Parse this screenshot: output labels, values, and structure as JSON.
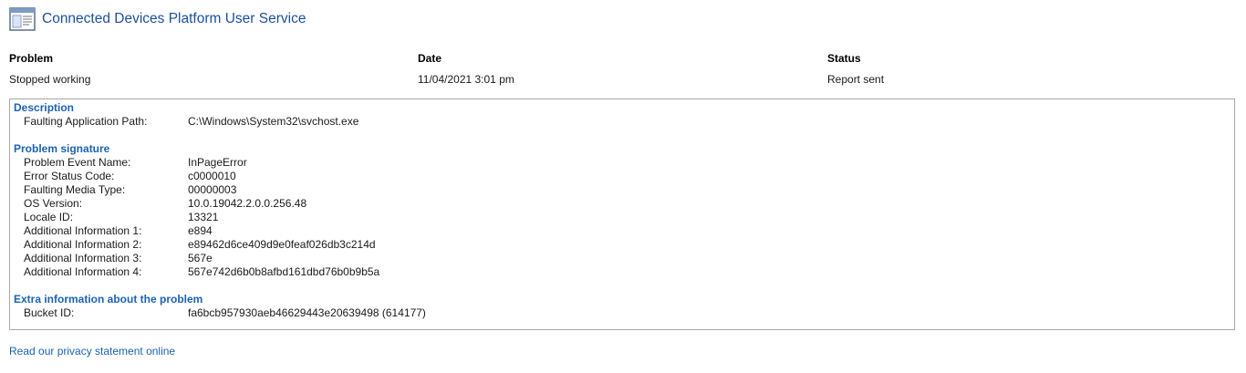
{
  "window": {
    "title": "Connected Devices Platform User Service",
    "icon": "report-document-icon"
  },
  "summary": {
    "headers": {
      "problem": "Problem",
      "date": "Date",
      "status": "Status"
    },
    "values": {
      "problem": "Stopped working",
      "date": "11/04/2021 3:01 pm",
      "status": "Report sent"
    }
  },
  "details": {
    "description": {
      "title": "Description",
      "rows": [
        {
          "key": "Faulting Application Path:",
          "value": "C:\\Windows\\System32\\svchost.exe"
        }
      ]
    },
    "signature": {
      "title": "Problem signature",
      "rows": [
        {
          "key": "Problem Event Name:",
          "value": "InPageError"
        },
        {
          "key": "Error Status Code:",
          "value": "c0000010"
        },
        {
          "key": "Faulting Media Type:",
          "value": "00000003"
        },
        {
          "key": "OS Version:",
          "value": "10.0.19042.2.0.0.256.48"
        },
        {
          "key": "Locale ID:",
          "value": "13321"
        },
        {
          "key": "Additional Information 1:",
          "value": "e894"
        },
        {
          "key": "Additional Information 2:",
          "value": "e89462d6ce409d9e0feaf026db3c214d"
        },
        {
          "key": "Additional Information 3:",
          "value": "567e"
        },
        {
          "key": "Additional Information 4:",
          "value": "567e742d6b0b8afbd161dbd76b0b9b5a"
        }
      ]
    },
    "extra": {
      "title": "Extra information about the problem",
      "rows": [
        {
          "key": "Bucket ID:",
          "value": "fa6bcb957930aeb46629443e20639498 (614177)"
        }
      ]
    }
  },
  "footer": {
    "privacy_link": "Read our privacy statement online"
  },
  "colors": {
    "title": "#1c4f9c",
    "link": "#1c62b3",
    "border": "#a8a8a8"
  }
}
